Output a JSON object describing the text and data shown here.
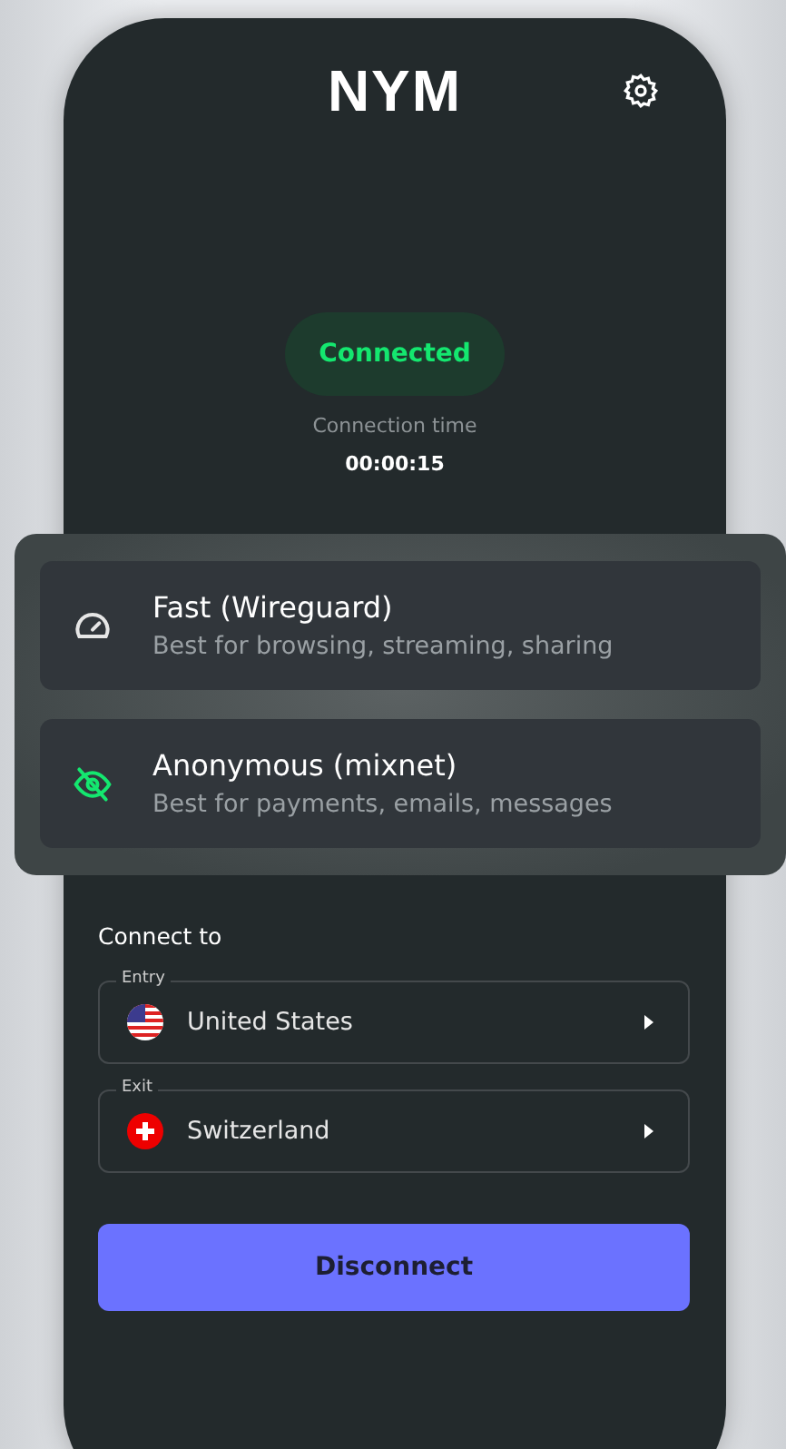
{
  "header": {
    "logo": "NYM"
  },
  "status": {
    "label": "Connected",
    "connected": true,
    "time_label": "Connection time",
    "time": "00:00:15"
  },
  "modes": [
    {
      "title": "Fast (Wireguard)",
      "description": "Best for browsing, streaming, sharing",
      "kind": "speed",
      "selected": false
    },
    {
      "title": "Anonymous (mixnet)",
      "description": "Best for payments, emails, messages",
      "kind": "privacy",
      "selected": true
    }
  ],
  "connect_to": {
    "heading": "Connect to",
    "nodes": [
      {
        "label": "Entry",
        "country": "United States",
        "kind": "us"
      },
      {
        "label": "Exit",
        "country": "Switzerland",
        "kind": "ch"
      }
    ]
  },
  "action": {
    "label": "Disconnect"
  }
}
